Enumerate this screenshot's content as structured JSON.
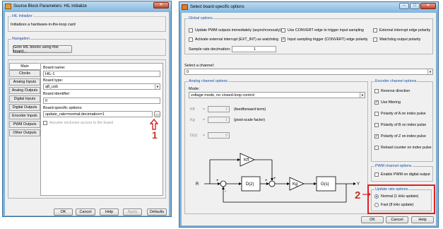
{
  "left_window": {
    "title": "Source Block Parameters: HIL Initialize",
    "section_title": "HIL Initialize",
    "description": "Initializes a hardware-in-the-loop card",
    "navigation_label": "Navigation",
    "goto_button": "Goto HIL blocks using this board...",
    "tabs": [
      "Main",
      "Clocks",
      "Analog Inputs",
      "Analog Outputs",
      "Digital Inputs",
      "Digital Outputs",
      "Encoder Inputs",
      "PWM Outputs",
      "Other Outputs"
    ],
    "board_name_label": "Board name:",
    "board_name_value": "HIL-1",
    "board_type_label": "Board type:",
    "board_type_value": "q8_usb",
    "board_identifier_label": "Board identifier:",
    "board_identifier_value": "0",
    "board_specific_label": "Board-specific options:",
    "board_specific_value": "update_rate=normal;decimation=1",
    "browse_label": "...",
    "exclusive_label": "Assume exclusive access to the board",
    "buttons": {
      "ok": "OK",
      "cancel": "Cancel",
      "help": "Help",
      "apply": "Apply",
      "defaults": "Defaults"
    }
  },
  "annotation1": "1",
  "annotation2": "2",
  "right_window": {
    "title": "Select board-specific options",
    "global": {
      "legend": "Global options",
      "update_pwm": "Update PWM outputs immediately (asynchronously)",
      "activate_ext": "Activate external interrupt (EXT_INT) as watchdog",
      "use_convert": "Use CONVERT edge to trigger input sampling",
      "input_sampling": "Input sampling trigger (CONVERT) edge polarity",
      "ext_interrupt_polarity": "External interrupt edge polarity",
      "watchdog_polarity": "Watchdog output polarity",
      "sample_rate_label": "Sample rate decimation:",
      "sample_rate_value": "1"
    },
    "channel": {
      "label": "Select a channel:",
      "value": "0"
    },
    "analog": {
      "legend": "Analog channel options",
      "mode_label": "Mode:",
      "mode_value": "voltage mode, no closed-loop control",
      "kff_label": "Kff",
      "kff_value": "1",
      "kff_desc": "(feedforward term)",
      "kg_label": "Kg",
      "kg_value": "1",
      "kg_desc": "(post-scale factor)",
      "dz_label": "D(z)",
      "dz_value": "0",
      "eq": "=",
      "diagram": {
        "kff": "Kff",
        "dz": "D(z)",
        "kg": "Kg",
        "gs": "G(s)",
        "r": "R",
        "y": "Y",
        "plus": "+",
        "minus": "-"
      }
    },
    "encoder": {
      "legend": "Encoder channel options",
      "reverse": "Reverse direction",
      "filtering": "Use filtering",
      "pol_a": "Polarity of A on index pulse",
      "pol_b": "Polarity of B on index pulse",
      "pol_z": "Polarity of Z on index pulse",
      "reload": "Reload counter on index pulse"
    },
    "pwm": {
      "legend": "PWM channel options",
      "enable": "Enable PWM on digital output"
    },
    "update_rate": {
      "legend": "Update rate options",
      "normal": "Normal (1 kHz update)",
      "fast": "Fast (8 kHz update)"
    },
    "buttons": {
      "ok": "OK",
      "cancel": "Cancel",
      "help": "Help"
    }
  },
  "colors": {
    "highlight_red": "#e02020",
    "link_blue": "#1a4fa3",
    "frame_blue": "#7eb2d8"
  }
}
